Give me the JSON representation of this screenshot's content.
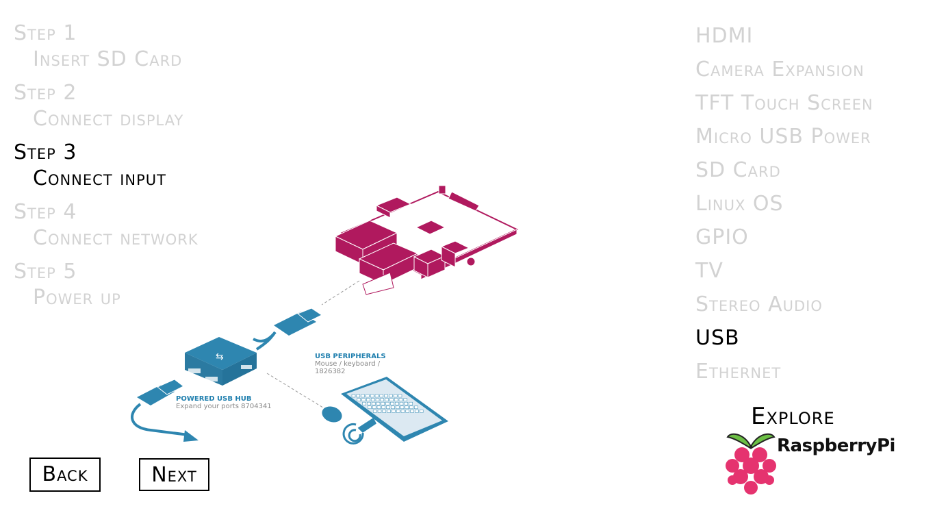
{
  "steps": [
    {
      "heading": "Step 1",
      "title": "Insert SD Card",
      "active": false
    },
    {
      "heading": "Step 2",
      "title": "Connect display",
      "active": false
    },
    {
      "heading": "Step 3",
      "title": "Connect input",
      "active": true
    },
    {
      "heading": "Step 4",
      "title": "Connect network",
      "active": false
    },
    {
      "heading": "Step 5",
      "title": "Power up",
      "active": false
    }
  ],
  "components": [
    {
      "label": "HDMI",
      "active": false
    },
    {
      "label": "Camera Expansion",
      "active": false
    },
    {
      "label": "TFT Touch Screen",
      "active": false
    },
    {
      "label": "Micro USB Power",
      "active": false
    },
    {
      "label": "SD Card",
      "active": false
    },
    {
      "label": "Linux OS",
      "active": false
    },
    {
      "label": "GPIO",
      "active": false
    },
    {
      "label": "TV",
      "active": false
    },
    {
      "label": "Stereo Audio",
      "active": false
    },
    {
      "label": "USB",
      "active": true
    },
    {
      "label": "Ethernet",
      "active": false
    }
  ],
  "nav": {
    "back_label": "Back",
    "next_label": "Next"
  },
  "explore": {
    "heading": "Explore",
    "brand": "RaspberryPi"
  },
  "illustration": {
    "hub_title": "POWERED USB HUB",
    "hub_desc": "Expand your ports 8704341",
    "peripherals_title": "USB PERIPHERALS",
    "peripherals_desc_1": "Mouse / keyboard /",
    "peripherals_desc_2": "1826382"
  },
  "colors": {
    "inactive_text": "#d2d2d2",
    "active_text": "#000000",
    "board": "#b0195e",
    "peripheral_blue": "#2e86b0",
    "raspberry_pink": "#e5336f",
    "leaf_green": "#6cbf45"
  }
}
